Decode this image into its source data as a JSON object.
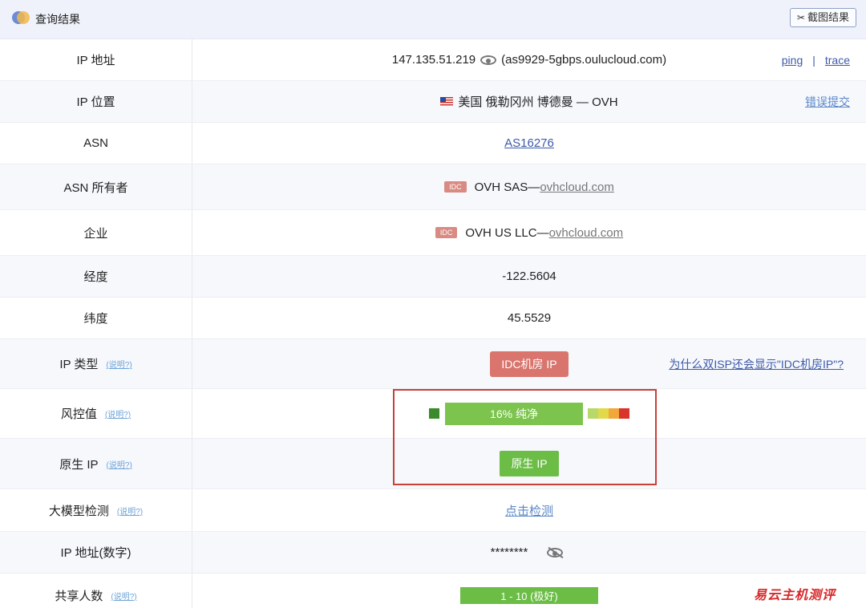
{
  "header": {
    "title": "查询结果",
    "screenshot_button": "截图结果",
    "screenshot_icon": "scissors-icon"
  },
  "rows": {
    "ip": {
      "label": "IP 地址",
      "address": "147.135.51.219",
      "hostname": "(as9929-5gbps.oulucloud.com)",
      "ping": "ping",
      "separator": "|",
      "trace": "trace"
    },
    "location": {
      "label": "IP 位置",
      "value": "美国 俄勒冈州 博德曼 — OVH",
      "report": "错误提交"
    },
    "asn": {
      "label": "ASN",
      "value": "AS16276"
    },
    "asn_owner": {
      "label": "ASN 所有者",
      "tag": "IDC",
      "name": "OVH SAS—",
      "domain": "ovhcloud.com"
    },
    "company": {
      "label": "企业",
      "tag": "IDC",
      "name": "OVH US LLC—",
      "domain": "ovhcloud.com"
    },
    "longitude": {
      "label": "经度",
      "value": "-122.5604"
    },
    "latitude": {
      "label": "纬度",
      "value": "45.5529"
    },
    "ip_type": {
      "label": "IP 类型",
      "hint": "(说明?)",
      "badge": "IDC机房 IP",
      "question": "为什么双ISP还会显示\"IDC机房IP\"?"
    },
    "risk": {
      "label": "风控值",
      "hint": "(说明?)",
      "value": "16%  纯净",
      "score_percent": 16,
      "scale_colors": [
        "#b9d86a",
        "#e2d94a",
        "#f0a83a",
        "#d9342b"
      ],
      "indicator_color": "#3b8a2b"
    },
    "native_ip": {
      "label": "原生 IP",
      "hint": "(说明?)",
      "badge": "原生 IP"
    },
    "llm_check": {
      "label": "大模型检测",
      "hint": "(说明?)",
      "action": "点击检测"
    },
    "ip_numeric": {
      "label": "IP 地址(数字)",
      "value": "********"
    },
    "shared": {
      "label": "共享人数",
      "hint": "(说明?)",
      "value": "1 - 10 (极好)"
    }
  },
  "watermark": "易云主机测评",
  "colors": {
    "header_bg": "#eff2fa",
    "alt_row_bg": "#f6f8fc",
    "link": "#3d5aa8",
    "idc_red": "#d9756d",
    "clean_green": "#6bbd46",
    "highlight": "#c9403a"
  }
}
